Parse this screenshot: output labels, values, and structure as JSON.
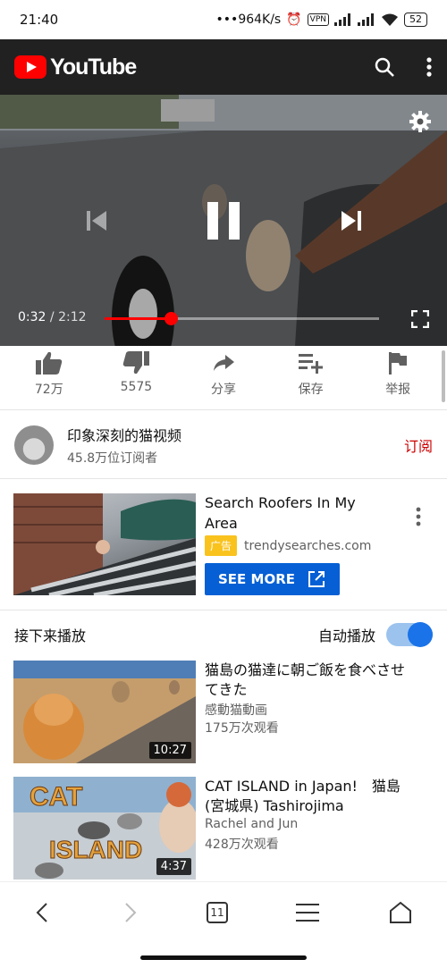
{
  "status": {
    "time": "21:40",
    "net_speed": "964K/s",
    "vpn": "VPN",
    "battery": "52"
  },
  "app": {
    "name": "YouTube",
    "brand_color": "#ff0000"
  },
  "player": {
    "current_time": "0:32",
    "separator": "/",
    "duration": "2:12",
    "progress": 0.24,
    "state": "playing"
  },
  "actions": [
    {
      "icon": "thumbs-up-icon",
      "label": "72万"
    },
    {
      "icon": "thumbs-down-icon",
      "label": "5575"
    },
    {
      "icon": "share-icon",
      "label": "分享"
    },
    {
      "icon": "playlist-add-icon",
      "label": "保存"
    },
    {
      "icon": "flag-icon",
      "label": "举报"
    }
  ],
  "channel": {
    "name": "印象深刻的猫视频",
    "subscribers": "45.8万位订阅者",
    "subscribe_label": "订阅"
  },
  "ad": {
    "title": "Search Roofers In My Area",
    "badge": "广告",
    "domain": "trendysearches.com",
    "cta": "SEE MORE"
  },
  "up_next": {
    "title": "接下来播放",
    "autoplay_label": "自动播放",
    "autoplay_on": true,
    "videos": [
      {
        "title": "猫島の猫達に朝ご飯を食べさせてきた",
        "channel": "感動猫動画",
        "views": "175万次观看",
        "duration": "10:27"
      },
      {
        "title": "CAT ISLAND in Japan!　猫島(宮城県) Tashirojima",
        "channel": "Rachel and Jun",
        "views": "428万次观看",
        "duration": "4:37",
        "thumb_text_top": "CAT",
        "thumb_text_bottom": "ISLAND"
      }
    ]
  },
  "browser": {
    "tab_count": "11"
  }
}
